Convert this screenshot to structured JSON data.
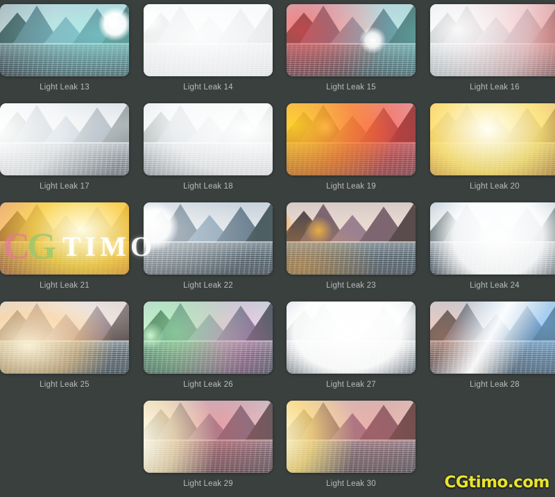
{
  "page": {
    "background_color": "#3a403e",
    "label_color": "#b9bdbc",
    "columns": 4,
    "thumb_width": 186,
    "thumb_height": 104
  },
  "watermarks": {
    "overlay": {
      "part1": "C",
      "part2": "G",
      "part3": "TIMO"
    },
    "corner": "CGtimo.com",
    "corner_color": "#e9e42a"
  },
  "items": [
    {
      "label": "Light Leak 13",
      "col": 0,
      "row": 0,
      "leak": "teal-right",
      "sky": "pastel"
    },
    {
      "label": "Light Leak 14",
      "col": 1,
      "row": 0,
      "leak": "white-wash",
      "sky": "pastel"
    },
    {
      "label": "Light Leak 15",
      "col": 2,
      "row": 0,
      "leak": "red-cyan",
      "sky": "pastel"
    },
    {
      "label": "Light Leak 16",
      "col": 3,
      "row": 0,
      "leak": "red-white",
      "sky": "pastel"
    },
    {
      "label": "Light Leak 17",
      "col": 0,
      "row": 1,
      "leak": "soft-white-left",
      "sky": "pastel"
    },
    {
      "label": "Light Leak 18",
      "col": 1,
      "row": 1,
      "leak": "white-right-glow",
      "sky": "pastel"
    },
    {
      "label": "Light Leak 19",
      "col": 2,
      "row": 1,
      "leak": "orange-red",
      "sky": "warm"
    },
    {
      "label": "Light Leak 20",
      "col": 3,
      "row": 1,
      "leak": "orange-sun",
      "sky": "warm"
    },
    {
      "label": "Light Leak 21",
      "col": 0,
      "row": 2,
      "leak": "orange-sunset",
      "sky": "warm"
    },
    {
      "label": "Light Leak 22",
      "col": 1,
      "row": 2,
      "leak": "white-left-big",
      "sky": "pastel"
    },
    {
      "label": "Light Leak 23",
      "col": 2,
      "row": 2,
      "leak": "orange-left",
      "sky": "warm"
    },
    {
      "label": "Light Leak 24",
      "col": 3,
      "row": 2,
      "leak": "white-center",
      "sky": "pastel"
    },
    {
      "label": "Light Leak 25",
      "col": 0,
      "row": 3,
      "leak": "warm-center-low",
      "sky": "warm"
    },
    {
      "label": "Light Leak 26",
      "col": 1,
      "row": 3,
      "leak": "green-magenta",
      "sky": "pastel"
    },
    {
      "label": "Light Leak 27",
      "col": 2,
      "row": 3,
      "leak": "white-blob",
      "sky": "pastel"
    },
    {
      "label": "Light Leak 28",
      "col": 3,
      "row": 3,
      "leak": "blue-streak",
      "sky": "pastel"
    },
    {
      "label": "Light Leak 29",
      "col": 1,
      "row": 4,
      "leak": "red-left-white",
      "sky": "pastel"
    },
    {
      "label": "Light Leak 30",
      "col": 2,
      "row": 4,
      "leak": "gold-left",
      "sky": "warm"
    }
  ]
}
